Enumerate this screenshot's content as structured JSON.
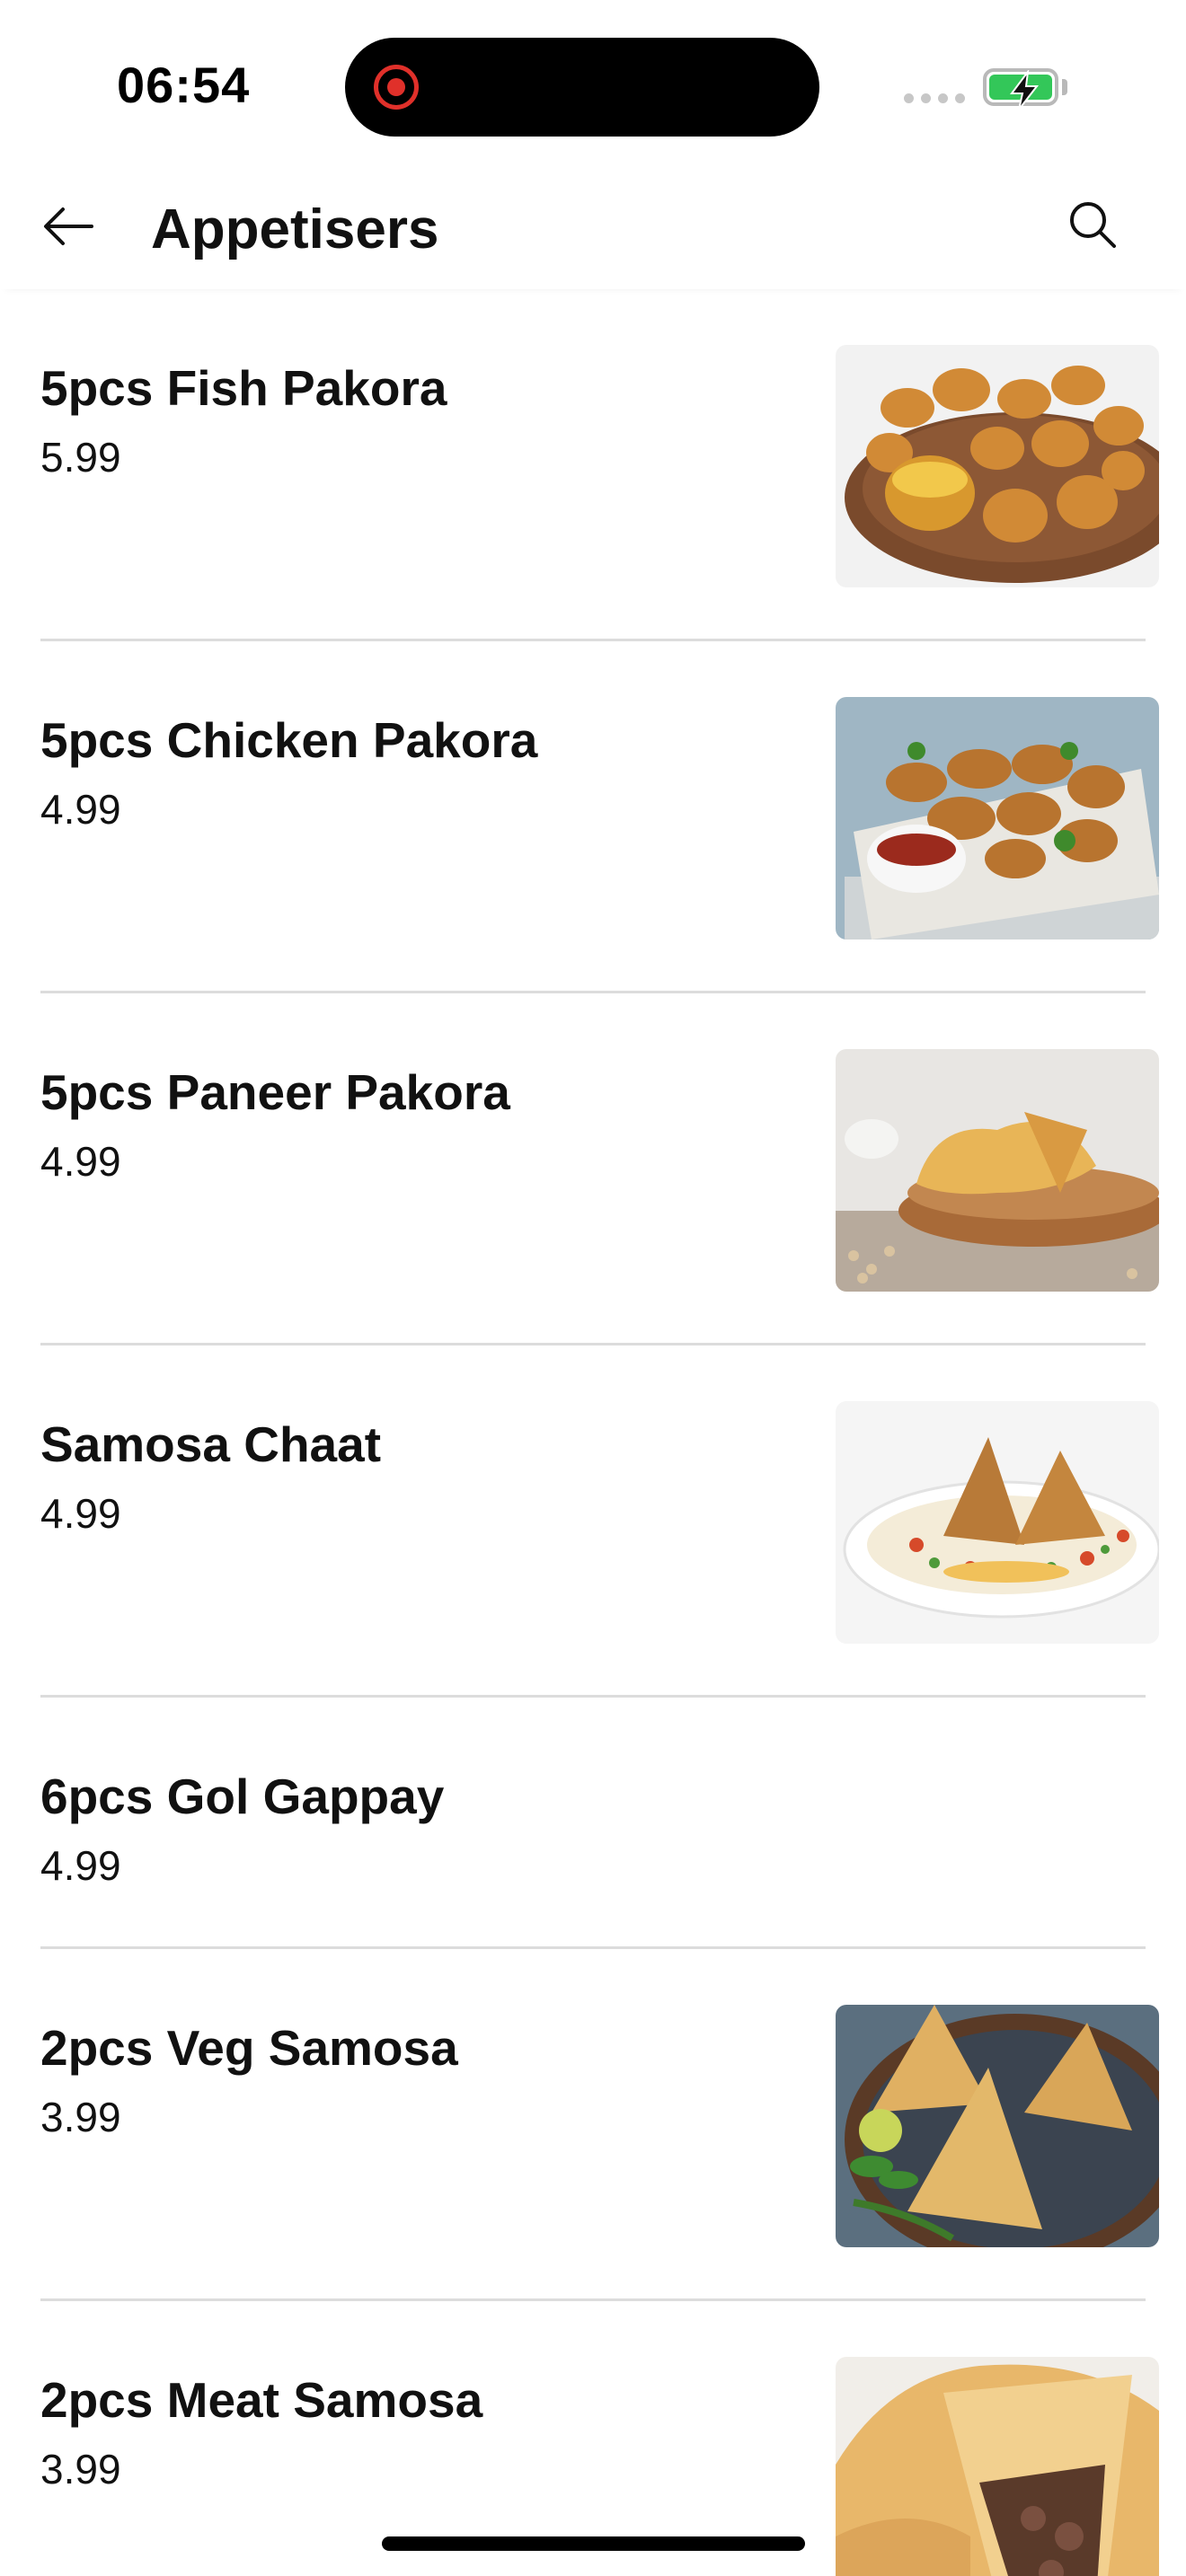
{
  "status_bar": {
    "time": "06:54"
  },
  "header": {
    "title": "Appetisers",
    "back_icon": "arrow-left-icon",
    "search_icon": "search-icon"
  },
  "items": [
    {
      "name": "5pcs Fish Pakora",
      "price": "5.99",
      "image": "fish-pakora-photo"
    },
    {
      "name": "5pcs Chicken Pakora",
      "price": "4.99",
      "image": "chicken-pakora-photo"
    },
    {
      "name": "5pcs Paneer Pakora",
      "price": "4.99",
      "image": "paneer-pakora-photo"
    },
    {
      "name": "Samosa Chaat",
      "price": "4.99",
      "image": "samosa-chaat-photo"
    },
    {
      "name": "6pcs Gol Gappay",
      "price": "4.99",
      "image": null
    },
    {
      "name": "2pcs Veg Samosa",
      "price": "3.99",
      "image": "veg-samosa-photo"
    },
    {
      "name": "2pcs Meat Samosa",
      "price": "3.99",
      "image": "meat-samosa-photo"
    }
  ],
  "colors": {
    "text": "#111111",
    "divider": "#dcdcdc",
    "battery": "#33c759",
    "record": "#e0302a"
  }
}
